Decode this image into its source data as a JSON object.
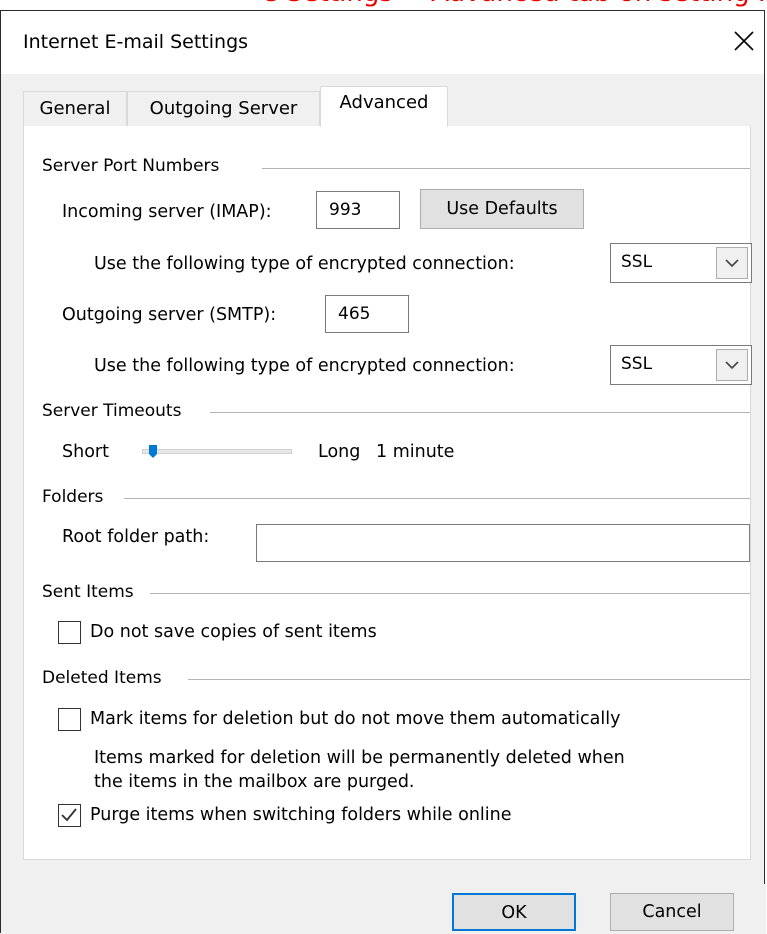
{
  "banner": {
    "text": "e Settings > Advanced tab on setting IMAP, comp"
  },
  "window": {
    "title": "Internet E-mail Settings",
    "close_icon": "close-icon"
  },
  "tabs": [
    {
      "label": "General"
    },
    {
      "label": "Outgoing Server"
    },
    {
      "label": "Advanced",
      "active": true
    }
  ],
  "server_ports": {
    "heading": "Server Port Numbers",
    "incoming_label": "Incoming server (IMAP):",
    "incoming_value": "993",
    "use_defaults": "Use Defaults",
    "encryption_label_1": "Use the following type of encrypted connection:",
    "encryption_value_1": "SSL",
    "outgoing_label": "Outgoing server (SMTP):",
    "outgoing_value": "465",
    "encryption_label_2": "Use the following type of encrypted connection:",
    "encryption_value_2": "SSL"
  },
  "timeouts": {
    "heading": "Server Timeouts",
    "short": "Short",
    "long": "Long",
    "value": "1 minute",
    "slider_fraction": 0.05
  },
  "folders": {
    "heading": "Folders",
    "root_label": "Root folder path:",
    "root_value": ""
  },
  "sent_items": {
    "heading": "Sent Items",
    "no_copies_label": "Do not save copies of sent items",
    "no_copies_checked": false
  },
  "deleted_items": {
    "heading": "Deleted Items",
    "mark_label": "Mark items for deletion but do not move them automatically",
    "mark_checked": false,
    "note_line1": "Items marked for deletion will be permanently deleted when",
    "note_line2": "the items in the mailbox are purged.",
    "purge_label": "Purge items when switching folders while online",
    "purge_checked": true
  },
  "buttons": {
    "ok": "OK",
    "cancel": "Cancel"
  },
  "colors": {
    "accent": "#0078d7",
    "banner": "#ee0000"
  }
}
